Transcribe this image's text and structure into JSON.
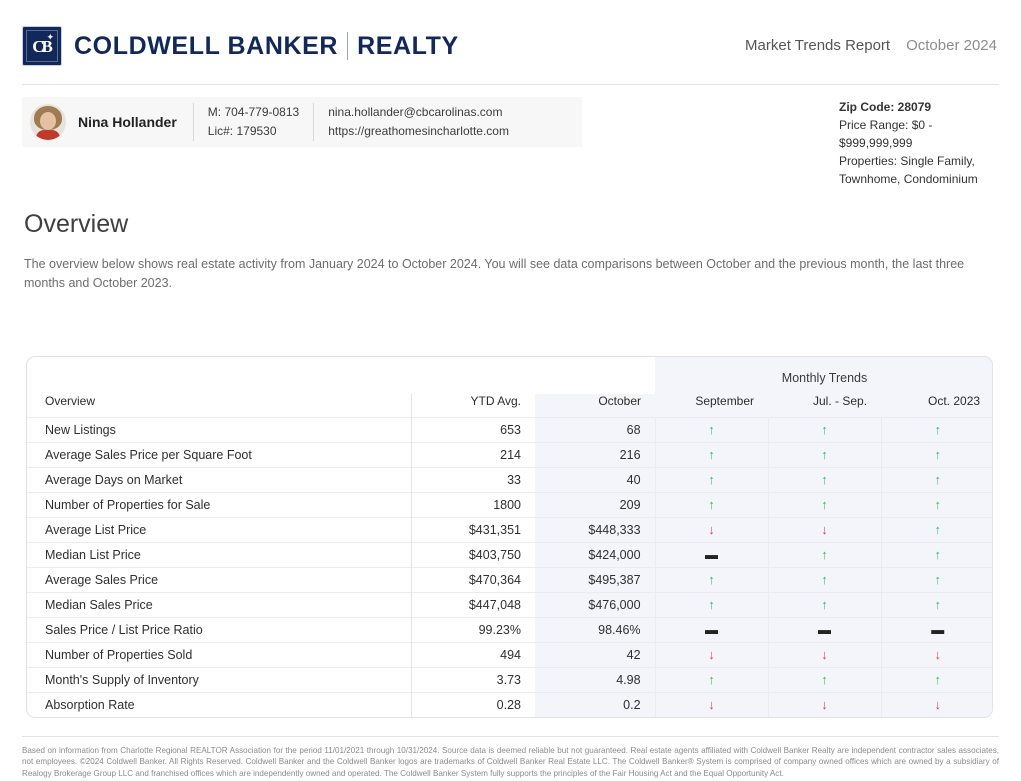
{
  "header": {
    "brand_primary": "COLDWELL BANKER",
    "brand_secondary": "REALTY",
    "logo_text": "CB",
    "logo_star": "✦",
    "report_title": "Market Trends Report",
    "report_date": "October 2024"
  },
  "agent": {
    "name": "Nina Hollander",
    "phone": "M: 704-779-0813",
    "license": "Lic#: 179530",
    "email": "nina.hollander@cbcarolinas.com",
    "website": "https://greathomesincharlotte.com"
  },
  "filters": {
    "zip_label": "Zip Code: ",
    "zip_value": "28079",
    "price_range": "Price Range: $0 - $999,999,999",
    "properties": "Properties: Single Family, Townhome, Condominium"
  },
  "overview": {
    "title": "Overview",
    "description": "The overview below shows real estate activity from January 2024 to October 2024. You will see data comparisons between October and the previous month, the last three months and October 2023."
  },
  "table": {
    "group_header": "Monthly Trends",
    "columns": [
      "Overview",
      "YTD Avg.",
      "October",
      "September",
      "Jul. - Sep.",
      "Oct. 2023"
    ],
    "rows": [
      {
        "label": "New Listings",
        "ytd": "653",
        "october": "68",
        "september": "up",
        "jul_sep": "up",
        "oct_2023": "up"
      },
      {
        "label": "Average Sales Price per Square Foot",
        "ytd": "214",
        "october": "216",
        "september": "up",
        "jul_sep": "up",
        "oct_2023": "up"
      },
      {
        "label": "Average Days on Market",
        "ytd": "33",
        "october": "40",
        "september": "up",
        "jul_sep": "up",
        "oct_2023": "up"
      },
      {
        "label": "Number of Properties for Sale",
        "ytd": "1800",
        "october": "209",
        "september": "up",
        "jul_sep": "up",
        "oct_2023": "up"
      },
      {
        "label": "Average List Price",
        "ytd": "$431,351",
        "october": "$448,333",
        "september": "down",
        "jul_sep": "down",
        "oct_2023": "up"
      },
      {
        "label": "Median List Price",
        "ytd": "$403,750",
        "october": "$424,000",
        "september": "flat",
        "jul_sep": "up",
        "oct_2023": "up"
      },
      {
        "label": "Average Sales Price",
        "ytd": "$470,364",
        "october": "$495,387",
        "september": "up",
        "jul_sep": "up",
        "oct_2023": "up"
      },
      {
        "label": "Median Sales Price",
        "ytd": "$447,048",
        "october": "$476,000",
        "september": "up",
        "jul_sep": "up",
        "oct_2023": "up"
      },
      {
        "label": "Sales Price / List Price Ratio",
        "ytd": "99.23%",
        "october": "98.46%",
        "september": "flat",
        "jul_sep": "flat",
        "oct_2023": "flat"
      },
      {
        "label": "Number of Properties Sold",
        "ytd": "494",
        "october": "42",
        "september": "down",
        "jul_sep": "down",
        "oct_2023": "down"
      },
      {
        "label": "Month's Supply of Inventory",
        "ytd": "3.73",
        "october": "4.98",
        "september": "up",
        "jul_sep": "up",
        "oct_2023": "up"
      },
      {
        "label": "Absorption Rate",
        "ytd": "0.28",
        "october": "0.2",
        "september": "down",
        "jul_sep": "down",
        "oct_2023": "down"
      }
    ],
    "trend_glyphs": {
      "up": "↑",
      "down": "↓",
      "flat": "▬"
    }
  },
  "footer": {
    "disclaimer": "Based on information from Charlotte Regional REALTOR Association for the period 11/01/2021 through 10/31/2024. Source data is deemed reliable but not guaranteed. Real estate agents affiliated with Coldwell Banker Realty are independent contractor sales associates, not employees. ©2024 Coldwell Banker. All Rights Reserved. Coldwell Banker and the Coldwell Banker logos are trademarks of Coldwell Banker Real Estate LLC. The Coldwell Banker® System is comprised of company owned offices which are owned by a subsidiary of Realogy Brokerage Group LLC and franchised offices which are independently owned and operated. The Coldwell Banker System fully supports the principles of the Fair Housing Act and the Equal Opportunity Act."
  },
  "colors": {
    "brand_navy": "#12285a",
    "trend_up": "#33c26a",
    "trend_down": "#e0464a",
    "tint": "#f4f4fb"
  }
}
